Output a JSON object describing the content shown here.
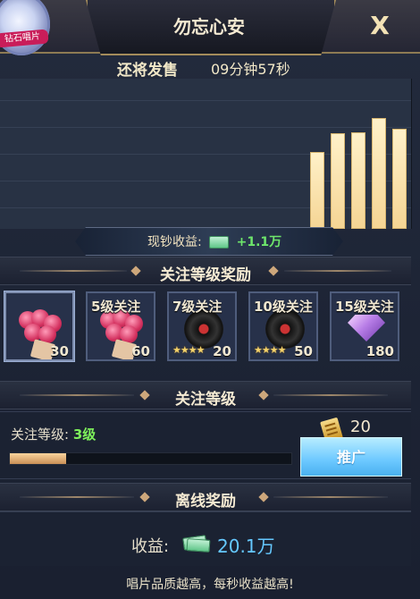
{
  "window": {
    "title": "勿忘心安",
    "close_label": "X",
    "badge_label": "钻石唱片"
  },
  "release": {
    "label": "还将发售",
    "countdown": "09分钟57秒"
  },
  "chart_data": {
    "type": "bar",
    "values": [
      86,
      107,
      108,
      124,
      112
    ],
    "ylim": [
      0,
      168
    ],
    "grid": true
  },
  "cash_income": {
    "label": "现钞收益:",
    "value": "+1.1万",
    "icon": "cash-icon"
  },
  "sections": {
    "follow_rewards": "关注等级奖励",
    "follow_level": "关注等级",
    "offline_rewards": "离线奖励"
  },
  "rewards": [
    {
      "label": "",
      "count": "30",
      "icon": "rose-bouquet-icon"
    },
    {
      "label": "5级关注",
      "count": "60",
      "icon": "rose-bouquet-icon"
    },
    {
      "label": "7级关注",
      "count": "20",
      "icon": "vinyl-record-icon"
    },
    {
      "label": "10级关注",
      "count": "50",
      "icon": "vinyl-record-icon"
    },
    {
      "label": "15级关注",
      "count": "180",
      "icon": "gem-icon"
    }
  ],
  "follow": {
    "label": "关注等级:",
    "level": "3级",
    "progress_fraction": 0.2,
    "book_count": "20",
    "promote_label": "推广"
  },
  "offline": {
    "label": "收益:",
    "value": "20.1万"
  },
  "footer": {
    "text": "唱片品质越高，每秒收益越高!"
  },
  "colors": {
    "accent_gold": "#cda77b",
    "income_green": "#6ee66b",
    "offline_blue": "#65c8ff",
    "button_blue": "#6cc8ff"
  }
}
